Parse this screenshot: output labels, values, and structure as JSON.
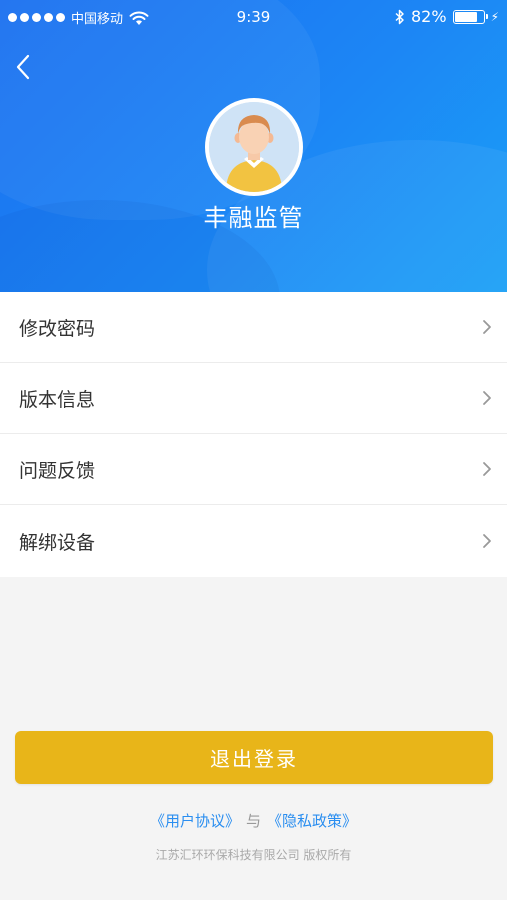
{
  "status_bar": {
    "carrier": "中国移动",
    "time": "9:39",
    "battery_text": "82%",
    "battery_level": 0.82,
    "icons": [
      "signal-dots-icon",
      "wifi-icon",
      "bluetooth-icon",
      "battery-icon",
      "charging-bolt-icon"
    ]
  },
  "header": {
    "back_icon": "chevron-left-icon",
    "avatar_icon": "user-avatar-icon",
    "username": "丰融监管",
    "colors": {
      "gradient_start": "#1a6ff0",
      "gradient_end": "#1aa0f6"
    }
  },
  "menu": {
    "items": [
      {
        "label": "修改密码",
        "icon": "chevron-right-icon"
      },
      {
        "label": "版本信息",
        "icon": "chevron-right-icon"
      },
      {
        "label": "问题反馈",
        "icon": "chevron-right-icon"
      },
      {
        "label": "解绑设备",
        "icon": "chevron-right-icon"
      }
    ]
  },
  "logout": {
    "label": "退出登录",
    "color": "#e8b519"
  },
  "footer": {
    "user_agreement": "《用户协议》",
    "connector": "与",
    "privacy_policy": "《隐私政策》",
    "copyright": "江苏汇环环保科技有限公司 版权所有",
    "link_color": "#2a8ef0"
  }
}
